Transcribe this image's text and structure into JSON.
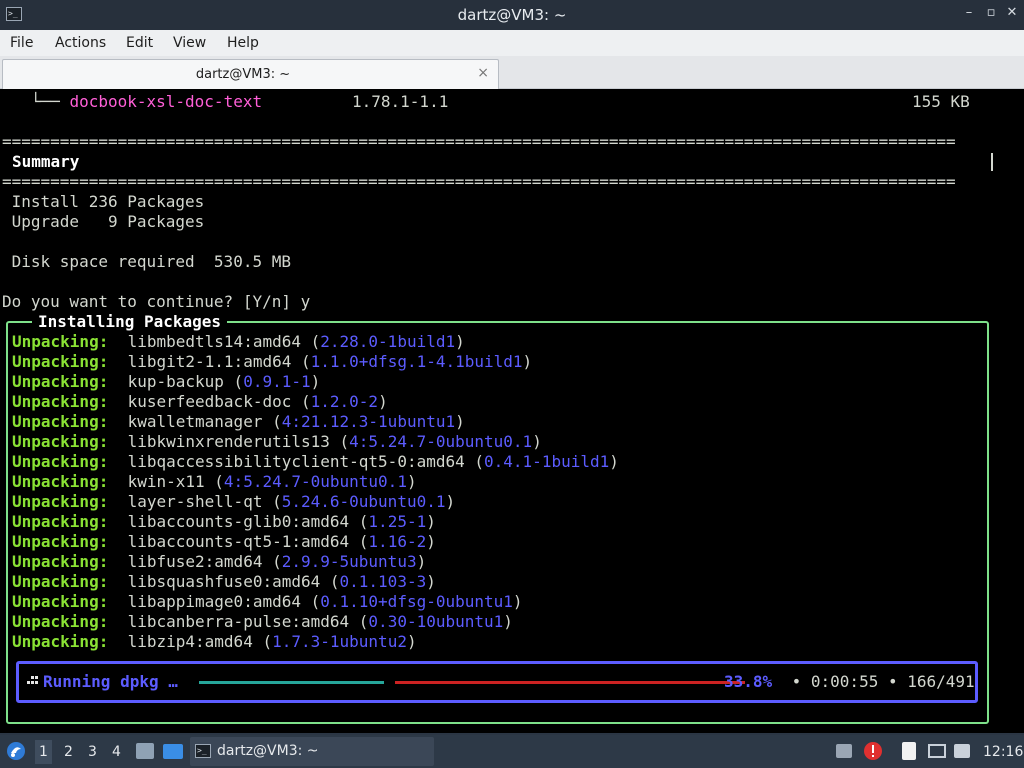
{
  "window": {
    "title": "dartz@VM3: ~",
    "controls": [
      "minimize-icon",
      "maximize-icon",
      "close-icon"
    ]
  },
  "menubar": {
    "items": [
      "File",
      "Actions",
      "Edit",
      "View",
      "Help"
    ]
  },
  "tabs": [
    {
      "label": "dartz@VM3: ~",
      "close": "×"
    }
  ],
  "terminal": {
    "tree_line": {
      "prefix": "   └── ",
      "package": "docbook-xsl-doc-text",
      "version": "1.78.1-1.1",
      "size": "155 KB"
    },
    "rule": "===================================================================================================",
    "summary_title": "Summary",
    "summary_lines": [
      " Install 236 Packages",
      " Upgrade   9 Packages",
      "",
      " Disk space required  530.5 MB"
    ],
    "prompt": "Do you want to continue? [Y/n] y",
    "install_box_title": "Installing Packages",
    "unpack_label": "Unpacking:",
    "unpacking": [
      {
        "name": "libmbedtls14:amd64",
        "version": "2.28.0-1build1"
      },
      {
        "name": "libgit2-1.1:amd64",
        "version": "1.1.0+dfsg.1-4.1build1"
      },
      {
        "name": "kup-backup",
        "version": "0.9.1-1"
      },
      {
        "name": "kuserfeedback-doc",
        "version": "1.2.0-2"
      },
      {
        "name": "kwalletmanager",
        "version": "4:21.12.3-1ubuntu1"
      },
      {
        "name": "libkwinxrenderutils13",
        "version": "4:5.24.7-0ubuntu0.1"
      },
      {
        "name": "libqaccessibilityclient-qt5-0:amd64",
        "version": "0.4.1-1build1"
      },
      {
        "name": "kwin-x11",
        "version": "4:5.24.7-0ubuntu0.1"
      },
      {
        "name": "layer-shell-qt",
        "version": "5.24.6-0ubuntu0.1"
      },
      {
        "name": "libaccounts-glib0:amd64",
        "version": "1.25-1"
      },
      {
        "name": "libaccounts-qt5-1:amd64",
        "version": "1.16-2"
      },
      {
        "name": "libfuse2:amd64",
        "version": "2.9.9-5ubuntu3"
      },
      {
        "name": "libsquashfuse0:amd64",
        "version": "0.1.103-3"
      },
      {
        "name": "libappimage0:amd64",
        "version": "0.1.10+dfsg-0ubuntu1"
      },
      {
        "name": "libcanberra-pulse:amd64",
        "version": "0.30-10ubuntu1"
      },
      {
        "name": "libzip4:amd64",
        "version": "1.7.3-1ubuntu2"
      }
    ],
    "progress": {
      "label": "Running dpkg …",
      "percent_text": "33.8%",
      "fraction": 0.338,
      "elapsed": "0:00:55",
      "count": "166/491",
      "stats_text": " • 0:00:55 • 166/491"
    }
  },
  "taskbar": {
    "workspaces": [
      "1",
      "2",
      "3",
      "4"
    ],
    "active_workspace": "1",
    "window_label": "dartz@VM3: ~",
    "clock": "12:16",
    "tray_icons": [
      "keyboard-layout-icon",
      "update-alert-icon",
      "clipboard-icon",
      "network-icon",
      "volume-icon"
    ]
  },
  "colors": {
    "green": "#8ae234",
    "blue": "#5c5cff",
    "pink": "#ff5fd7",
    "box_border": "#7ee08a",
    "bar_done": "#26a69a",
    "bar_todo": "#cc2222"
  }
}
